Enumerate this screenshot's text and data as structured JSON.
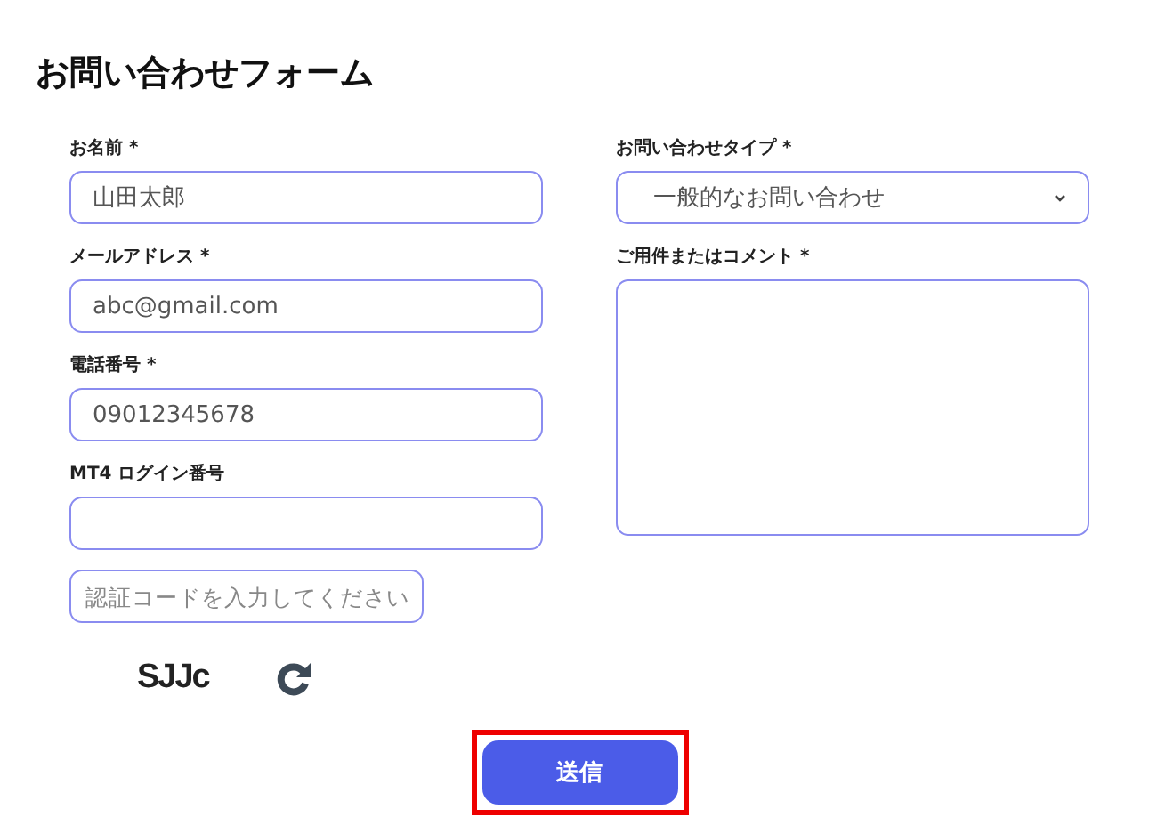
{
  "title": "お問い合わせフォーム",
  "left_fields": [
    {
      "kind": "text",
      "label": "お名前 *",
      "value": "山田太郎"
    },
    {
      "kind": "text",
      "label": "メールアドレス *",
      "value": "abc@gmail.com"
    },
    {
      "kind": "text",
      "label": "電話番号 *",
      "value": "09012345678"
    },
    {
      "kind": "text",
      "label": "MT4 ログイン番号"
    }
  ],
  "right_fields": [
    {
      "kind": "select",
      "label": "お問い合わせタイプ *",
      "value": "一般的なお問い合わせ"
    },
    {
      "kind": "textarea",
      "label": "ご用件またはコメント *"
    }
  ],
  "captcha": {
    "placeholder": "認証コードを入力してください",
    "code": "SJJc"
  },
  "submit": {
    "label": "送信",
    "highlighted": true
  }
}
